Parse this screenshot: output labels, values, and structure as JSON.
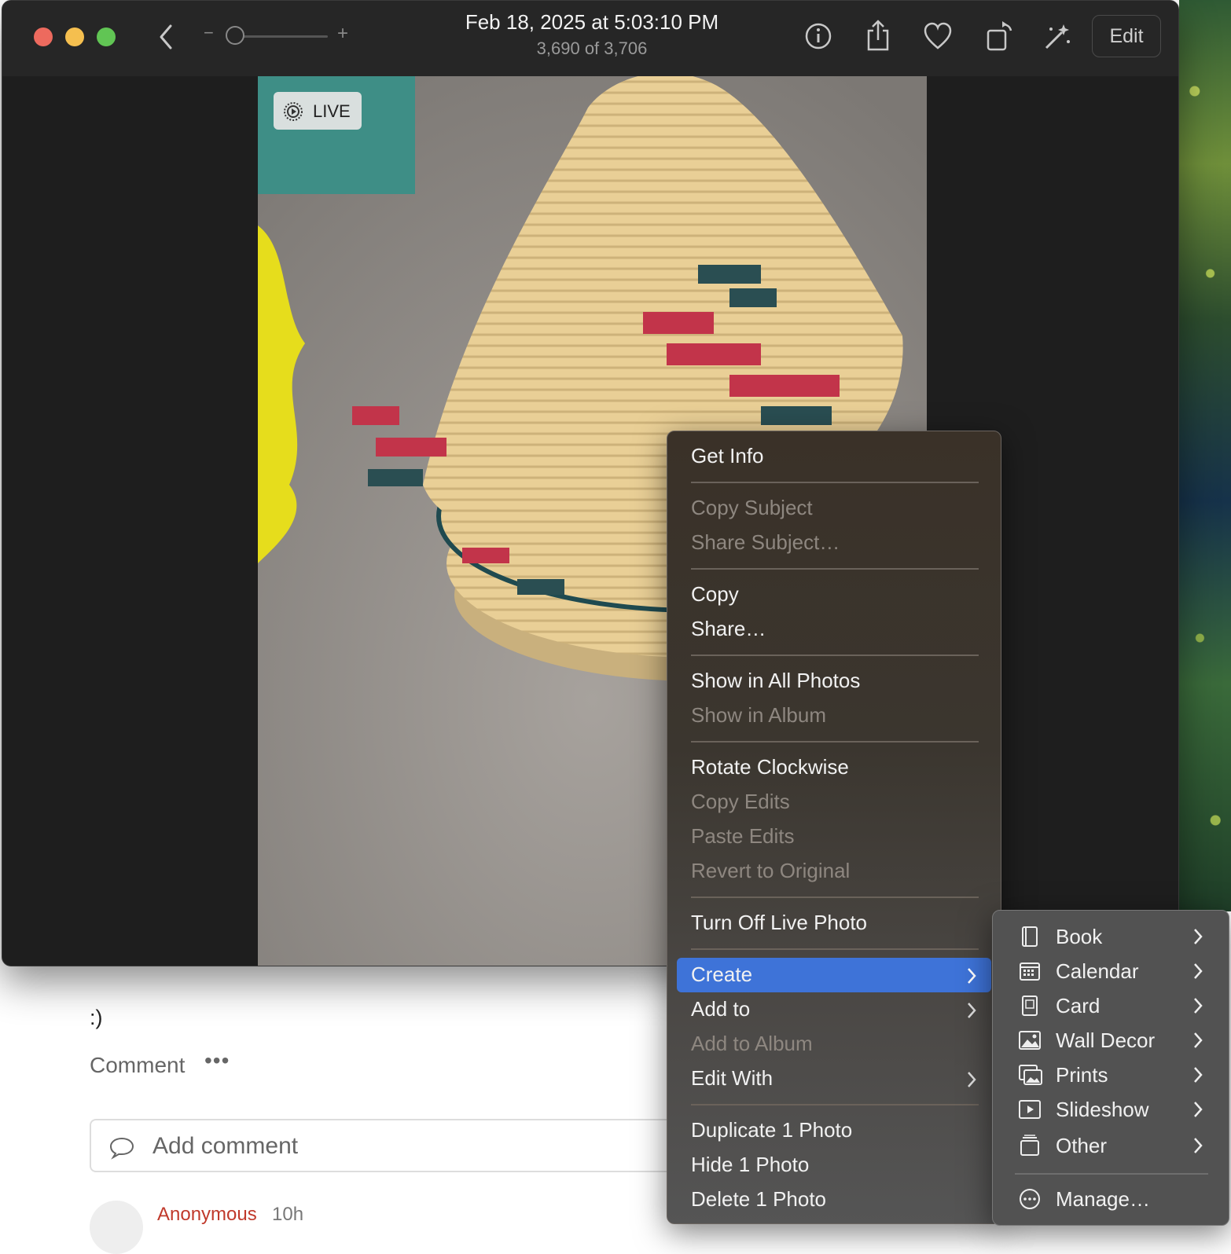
{
  "webpage": {
    "smile": ":)",
    "comment_label": "Comment",
    "more_dots": "•••",
    "comment_placeholder": "Add comment",
    "author": "Anonymous",
    "time": "10h"
  },
  "window": {
    "title": "Feb 18, 2025 at 5:03:10 PM",
    "subtitle": "3,690 of 3,706",
    "zoom_minus": "−",
    "zoom_plus": "+",
    "edit_label": "Edit",
    "live_label": "LIVE",
    "toolbar_icons": [
      "info-icon",
      "share-icon",
      "heart-icon",
      "rotate-icon",
      "magic-wand-icon"
    ]
  },
  "menu": {
    "items": [
      {
        "label": "Get Info",
        "enabled": true
      },
      {
        "label": "Copy Subject",
        "enabled": false
      },
      {
        "label": "Share Subject…",
        "enabled": false
      },
      {
        "label": "Copy",
        "enabled": true
      },
      {
        "label": "Share…",
        "enabled": true
      },
      {
        "label": "Show in All Photos",
        "enabled": true
      },
      {
        "label": "Show in Album",
        "enabled": false
      },
      {
        "label": "Rotate Clockwise",
        "enabled": true
      },
      {
        "label": "Copy Edits",
        "enabled": false
      },
      {
        "label": "Paste Edits",
        "enabled": false
      },
      {
        "label": "Revert to Original",
        "enabled": false
      },
      {
        "label": "Turn Off Live Photo",
        "enabled": true
      },
      {
        "label": "Create",
        "enabled": true,
        "highlighted": true,
        "submenu": true
      },
      {
        "label": "Add to",
        "enabled": true,
        "submenu": true
      },
      {
        "label": "Add to Album",
        "enabled": false
      },
      {
        "label": "Edit With",
        "enabled": true,
        "submenu": true
      },
      {
        "label": "Duplicate 1 Photo",
        "enabled": true
      },
      {
        "label": "Hide 1 Photo",
        "enabled": true
      },
      {
        "label": "Delete 1 Photo",
        "enabled": true
      }
    ]
  },
  "submenu": {
    "items": [
      {
        "label": "Book",
        "icon": "book-icon"
      },
      {
        "label": "Calendar",
        "icon": "calendar-icon"
      },
      {
        "label": "Card",
        "icon": "card-icon"
      },
      {
        "label": "Wall Decor",
        "icon": "wall-decor-icon"
      },
      {
        "label": "Prints",
        "icon": "prints-icon"
      },
      {
        "label": "Slideshow",
        "icon": "slideshow-icon"
      },
      {
        "label": "Other",
        "icon": "other-icon"
      },
      {
        "label": "Manage…",
        "icon": "manage-icon"
      }
    ]
  },
  "colors": {
    "highlight": "#3e73d8",
    "author": "#c0392b"
  }
}
